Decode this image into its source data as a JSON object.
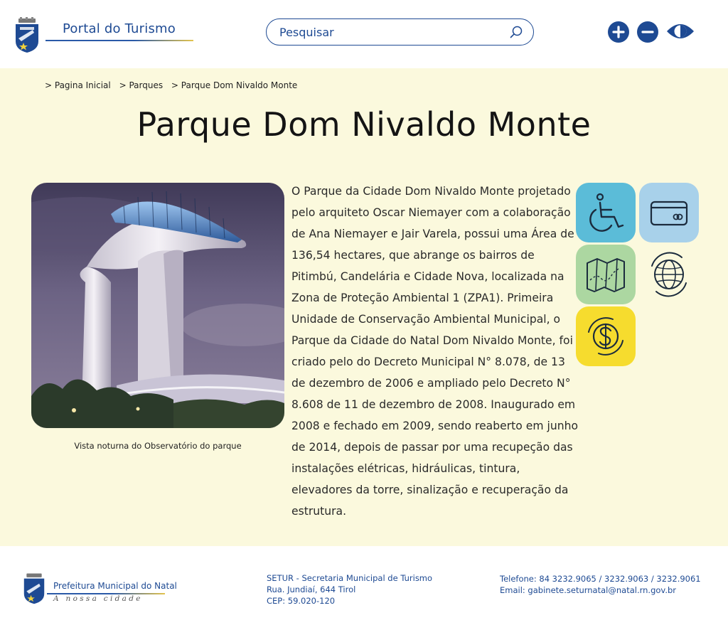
{
  "header": {
    "portal_title": "Portal do Turismo",
    "search_placeholder": "Pesquisar",
    "icons": [
      "crest-icon",
      "search-icon",
      "zoom-in-icon",
      "zoom-out-icon",
      "contrast-eye-icon"
    ]
  },
  "breadcrumb": [
    "> Pagina Inicial",
    "> Parques",
    "> Parque Dom Nivaldo Monte"
  ],
  "page": {
    "title": "Parque Dom Nivaldo Monte",
    "photo_caption": "Vista noturna do Observatório do parque",
    "description": "O Parque da Cidade Dom Nivaldo Monte projetado pelo arquiteto Oscar Niemayer com a colaboração de Ana Niemayer e Jair Varela, possui uma Área de 136,54 hectares, que abrange os bairros de Pitimbú, Candelária e Cidade Nova, localizada na Zona de Proteção Ambiental 1 (ZPA1). Primeira Unidade de Conservação Ambiental Municipal, o Parque da Cidade do Natal Dom Nivaldo Monte, foi criado pelo do Decreto Municipal N° 8.078, de 13 de dezembro de 2006 e ampliado pelo Decreto N° 8.608 de 11 de dezembro de 2008. Inaugurado em 2008 e fechado em 2009, sendo reaberto em junho de 2014, depois de passar por uma recupeção das instalações elétricas, hidráulicas, tintura, elevadores da torre, sinalização e recuperação da estrutura."
  },
  "feature_icons": [
    {
      "name": "accessibility-icon",
      "color": "#5bbcd8"
    },
    {
      "name": "credit-card-icon",
      "color": "#a8d1ea"
    },
    {
      "name": "map-icon",
      "color": "#acd7a1"
    },
    {
      "name": "globe-icon",
      "color": "#fbf9dd"
    },
    {
      "name": "money-icon",
      "color": "#f6dc2e"
    }
  ],
  "footer": {
    "org_name": "Prefeitura Municipal do Natal",
    "tagline": "A nossa cidade",
    "address": [
      "SETUR - Secretaria Municipal de Turismo",
      "Rua. Jundiaí, 644 Tirol",
      "CEP: 59.020-120"
    ],
    "contact": [
      "Telefone: 84 3232.9065 / 3232.9063 / 3232.9061",
      "Email: gabinete.seturnatal@natal.rn.gov.br"
    ]
  },
  "colors": {
    "brand_blue": "#1e4a93",
    "content_background": "#fbf9dd",
    "accent_gold": "#e4c44d"
  }
}
